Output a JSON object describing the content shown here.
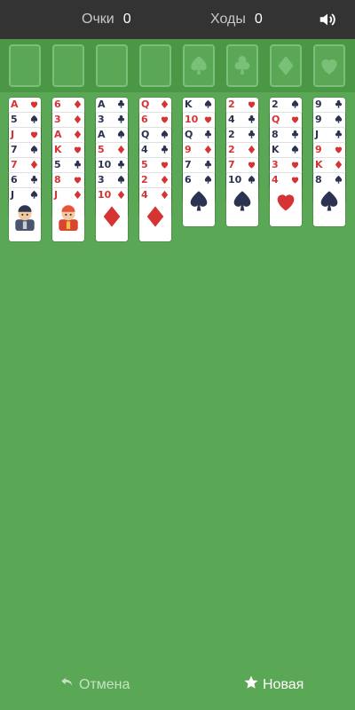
{
  "header": {
    "score_label": "Очки",
    "score_value": "0",
    "moves_label": "Ходы",
    "moves_value": "0",
    "sound_icon": "speaker-icon"
  },
  "freecells": [
    {
      "suit": ""
    },
    {
      "suit": ""
    },
    {
      "suit": ""
    },
    {
      "suit": ""
    }
  ],
  "foundations": [
    {
      "suit": "spade"
    },
    {
      "suit": "club"
    },
    {
      "suit": "diamond"
    },
    {
      "suit": "heart"
    }
  ],
  "tableau": [
    [
      {
        "r": "A",
        "s": "heart"
      },
      {
        "r": "5",
        "s": "spade"
      },
      {
        "r": "J",
        "s": "heart"
      },
      {
        "r": "7",
        "s": "spade"
      },
      {
        "r": "7",
        "s": "diamond"
      },
      {
        "r": "6",
        "s": "club"
      },
      {
        "r": "J",
        "s": "spade",
        "face": true
      }
    ],
    [
      {
        "r": "6",
        "s": "diamond"
      },
      {
        "r": "3",
        "s": "diamond"
      },
      {
        "r": "A",
        "s": "diamond"
      },
      {
        "r": "K",
        "s": "heart"
      },
      {
        "r": "5",
        "s": "club"
      },
      {
        "r": "8",
        "s": "heart"
      },
      {
        "r": "J",
        "s": "diamond",
        "face": true
      }
    ],
    [
      {
        "r": "A",
        "s": "club"
      },
      {
        "r": "3",
        "s": "club"
      },
      {
        "r": "A",
        "s": "spade"
      },
      {
        "r": "5",
        "s": "diamond"
      },
      {
        "r": "10",
        "s": "club"
      },
      {
        "r": "3",
        "s": "spade"
      },
      {
        "r": "10",
        "s": "diamond"
      }
    ],
    [
      {
        "r": "Q",
        "s": "diamond"
      },
      {
        "r": "6",
        "s": "heart"
      },
      {
        "r": "Q",
        "s": "spade"
      },
      {
        "r": "4",
        "s": "club"
      },
      {
        "r": "5",
        "s": "heart"
      },
      {
        "r": "2",
        "s": "diamond"
      },
      {
        "r": "4",
        "s": "diamond"
      }
    ],
    [
      {
        "r": "K",
        "s": "spade"
      },
      {
        "r": "10",
        "s": "heart"
      },
      {
        "r": "Q",
        "s": "club"
      },
      {
        "r": "9",
        "s": "diamond"
      },
      {
        "r": "7",
        "s": "club"
      },
      {
        "r": "6",
        "s": "spade"
      }
    ],
    [
      {
        "r": "2",
        "s": "heart"
      },
      {
        "r": "4",
        "s": "club"
      },
      {
        "r": "2",
        "s": "club"
      },
      {
        "r": "2",
        "s": "diamond"
      },
      {
        "r": "7",
        "s": "heart"
      },
      {
        "r": "10",
        "s": "spade"
      }
    ],
    [
      {
        "r": "2",
        "s": "spade"
      },
      {
        "r": "Q",
        "s": "heart"
      },
      {
        "r": "8",
        "s": "club"
      },
      {
        "r": "K",
        "s": "spade"
      },
      {
        "r": "3",
        "s": "heart"
      },
      {
        "r": "4",
        "s": "heart"
      }
    ],
    [
      {
        "r": "9",
        "s": "club"
      },
      {
        "r": "9",
        "s": "spade"
      },
      {
        "r": "J",
        "s": "club"
      },
      {
        "r": "9",
        "s": "heart"
      },
      {
        "r": "K",
        "s": "diamond"
      },
      {
        "r": "8",
        "s": "spade"
      }
    ]
  ],
  "controls": {
    "undo_label": "Отмена",
    "new_label": "Новая"
  },
  "colors": {
    "felt": "#5aa855",
    "topbar": "#333333",
    "red_suit": "#d63434",
    "black_suit": "#2c3350"
  }
}
